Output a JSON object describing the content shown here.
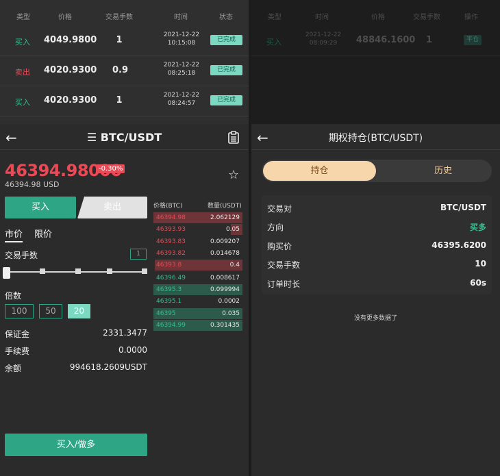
{
  "left": {
    "orders": {
      "headers": [
        "类型",
        "价格",
        "交易手数",
        "时间",
        "状态"
      ],
      "rows": [
        {
          "type": "买入",
          "side": "buy",
          "price": "4049.9800",
          "qty": "1",
          "date": "2021-12-22",
          "time": "10:15:08",
          "status": "已完成"
        },
        {
          "type": "卖出",
          "side": "sell",
          "price": "4020.9300",
          "qty": "0.9",
          "date": "2021-12-22",
          "time": "08:25:18",
          "status": "已完成"
        },
        {
          "type": "买入",
          "side": "buy",
          "price": "4020.9300",
          "qty": "1",
          "date": "2021-12-22",
          "time": "08:24:57",
          "status": "已完成"
        }
      ]
    },
    "header": {
      "back": "←",
      "menu_icon": "☰",
      "title": "BTC/USDT",
      "doc_icon": "clipboard-icon"
    },
    "ticker": {
      "price": "46394.98000",
      "change": "-0.30%",
      "usd": "46394.98 USD"
    },
    "trade_tabs": {
      "buy": "买入",
      "sell": "卖出"
    },
    "order_types": {
      "market": "市价",
      "limit": "限价"
    },
    "qty_label": "交易手数",
    "qty_value": "1",
    "slider_fraction": 0,
    "leverage": {
      "label": "倍数",
      "options": [
        "100",
        "50",
        "20"
      ],
      "selected": "20"
    },
    "summary": [
      {
        "k": "保证金",
        "v": "2331.3477"
      },
      {
        "k": "手续费",
        "v": "0.0000"
      },
      {
        "k": "余额",
        "v": "994618.2609USDT"
      }
    ],
    "book": {
      "price_header": "价格(BTC)",
      "qty_header": "数量(USDT)",
      "asks": [
        {
          "p": "46394.98",
          "q": "2.062129",
          "depth": 1.0
        },
        {
          "p": "46393.93",
          "q": "0.05",
          "depth": 0.13
        },
        {
          "p": "46393.83",
          "q": "0.009207",
          "depth": 0.0
        },
        {
          "p": "46393.82",
          "q": "0.014678",
          "depth": 0.0
        },
        {
          "p": "46393.8",
          "q": "0.4",
          "depth": 0.98
        }
      ],
      "bids": [
        {
          "p": "46396.49",
          "q": "0.008617",
          "depth": 0.0
        },
        {
          "p": "46395.3",
          "q": "0.099994",
          "depth": 1.0
        },
        {
          "p": "46395.1",
          "q": "0.0002",
          "depth": 0.0
        },
        {
          "p": "46395",
          "q": "0.035",
          "depth": 1.0
        },
        {
          "p": "46394.99",
          "q": "0.301435",
          "depth": 1.0
        }
      ]
    },
    "submit": "买入/做多"
  },
  "right": {
    "orders": {
      "headers": [
        "类型",
        "时间",
        "价格",
        "交易手数",
        "操作"
      ],
      "row": {
        "type": "买入",
        "date": "2021-12-22",
        "time": "08:09:29",
        "price": "48846.1600",
        "qty": "1",
        "action": "平仓"
      }
    },
    "header": {
      "back": "←",
      "title": "期权持仓(BTC/USDT)"
    },
    "tabs": {
      "active": "持仓",
      "other": "历史"
    },
    "position": [
      {
        "k": "交易对",
        "v": "BTC/USDT"
      },
      {
        "k": "方向",
        "v": "买多"
      },
      {
        "k": "购买价",
        "v": "46395.6200"
      },
      {
        "k": "交易手数",
        "v": "10"
      },
      {
        "k": "订单时长",
        "v": "60s"
      }
    ],
    "no_more": "没有更多数据了"
  },
  "colors": {
    "green": "#2ea585",
    "red": "#ea4a55",
    "bg": "#2b2b2c",
    "gold": "#f8d6ac"
  }
}
